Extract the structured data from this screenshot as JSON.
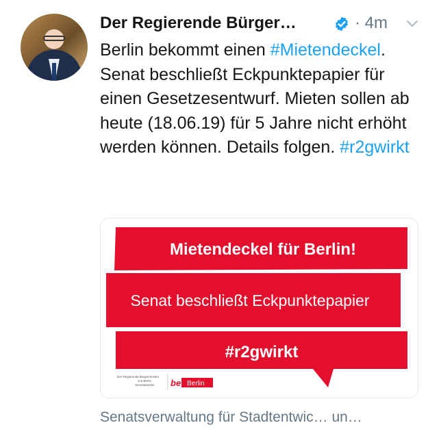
{
  "tweet": {
    "author_name": "Der Regierende Bürger…",
    "timestamp": "· 4m",
    "text_parts": [
      {
        "text": "Berlin bekommt einen ",
        "kind": "plain"
      },
      {
        "text": "#Mietendeckel",
        "kind": "hashtag"
      },
      {
        "text": ". Senat beschließt Eckpunktepapier für einen Gesetzesentwurf. Mieten sollen ab heute (18.06.19) für 5 Jahre nicht erhöht werden können. Details folgen. ",
        "kind": "plain"
      },
      {
        "text": "#r2gwirkt",
        "kind": "hashtag"
      }
    ]
  },
  "card": {
    "headline": "Mietendeckel für Berlin!",
    "subline": "Senat beschließt Eckpunktepapier",
    "hashtag": "#r2gwirkt",
    "sender_line1": "Der Regierende Bürgermeister",
    "sender_line2": "von Berlin",
    "sender_line3": "Senatskanzlei",
    "logo_be": "be",
    "logo_berlin": "Berlin",
    "footer_link": "Senatsverwaltung für Stadtentwic… un…"
  },
  "colors": {
    "brand_red": "#e30f2d",
    "link_blue": "#1da1f2",
    "verified_blue": "#1da1f2",
    "muted_gray": "#657786"
  },
  "icons": {
    "verified": "verified-badge-icon",
    "chevron": "chevron-down-icon"
  }
}
